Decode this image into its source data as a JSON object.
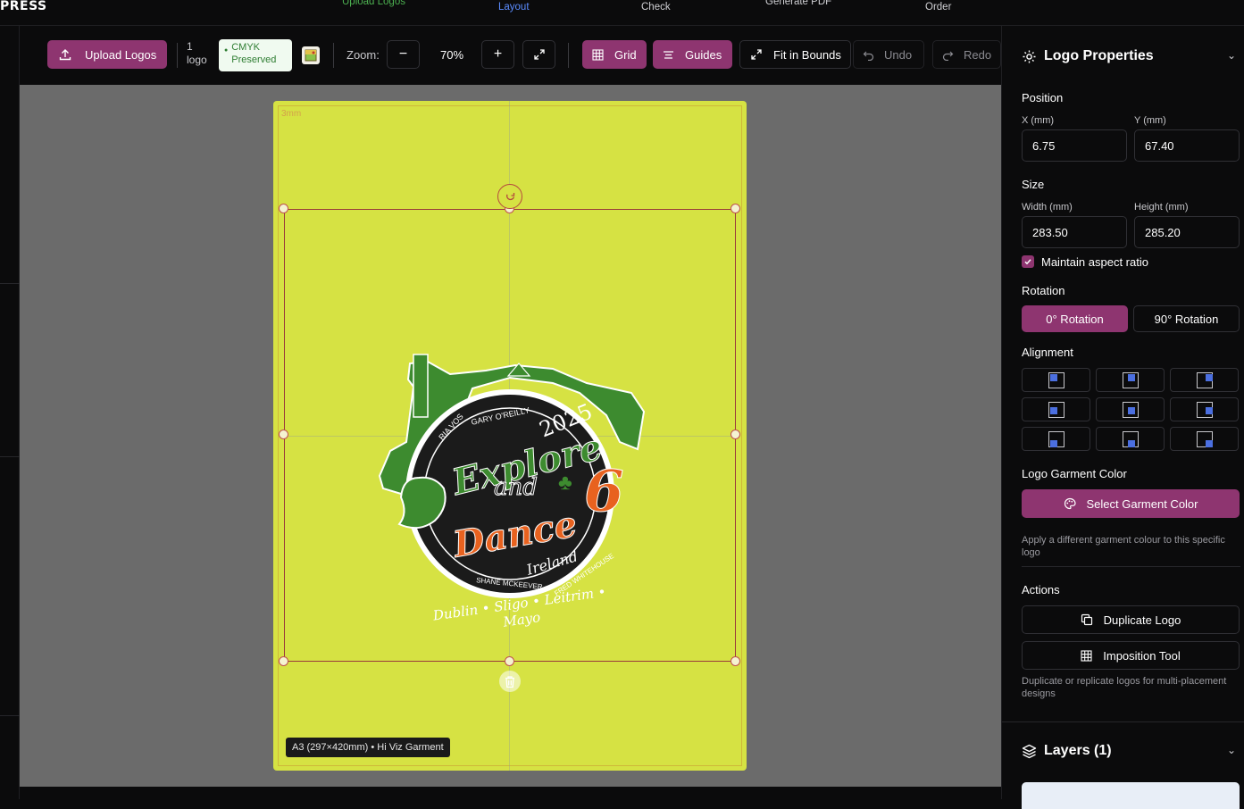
{
  "brand": "PRESS",
  "steps": [
    {
      "label": "Upload Logos",
      "state": "done"
    },
    {
      "label": "Layout",
      "state": "active"
    },
    {
      "label": "Check",
      "state": "todo"
    },
    {
      "label": "Generate PDF",
      "state": "todo"
    },
    {
      "label": "Order",
      "state": "todo"
    }
  ],
  "toolbar": {
    "upload_label": "Upload Logos",
    "logo_count": "1",
    "logo_unit": "logo",
    "cmyk_line1": "CMYK",
    "cmyk_line2": "Preserved",
    "zoom_label": "Zoom:",
    "zoom_value": "70%",
    "grid_label": "Grid",
    "guides_label": "Guides",
    "fit_label": "Fit in Bounds",
    "undo_label": "Undo",
    "redo_label": "Redo"
  },
  "canvas": {
    "bleed_label": "3mm",
    "size_label": "A3 (297×420mm) • Hi Viz Garment",
    "garment_color": "#d6e243"
  },
  "logo": {
    "ring_top_left": "RIA VOS",
    "ring_top": "GARY O'REILLY",
    "year": "2025",
    "word1": "Explore",
    "word2": "and",
    "word3": "Dance",
    "number": "6",
    "script": "Ireland",
    "ring_bottom_left": "SHANE MCKEEVER",
    "ring_bottom_right": "FRED WHITEHOUSE",
    "banner": "Dublin • Sligo • Leitrim • Mayo"
  },
  "sidebar": {
    "title": "Logo Properties",
    "position_label": "Position",
    "x_label": "X (mm)",
    "x_value": "6.75",
    "y_label": "Y (mm)",
    "y_value": "67.40",
    "size_label": "Size",
    "width_label": "Width (mm)",
    "width_value": "283.50",
    "height_label": "Height (mm)",
    "height_value": "285.20",
    "aspect_label": "Maintain aspect ratio",
    "aspect_checked": true,
    "rotation_label": "Rotation",
    "rot0_label": "0° Rotation",
    "rot90_label": "90° Rotation",
    "alignment_label": "Alignment",
    "garment_color_label": "Logo Garment Color",
    "select_color_label": "Select Garment Color",
    "garment_hint": "Apply a different garment colour to this specific logo",
    "actions_label": "Actions",
    "duplicate_label": "Duplicate Logo",
    "imposition_label": "Imposition Tool",
    "actions_hint": "Duplicate or replicate logos for multi-placement designs",
    "layers_label": "Layers (1)"
  },
  "colors": {
    "accent": "#8e3570",
    "active_step": "#5b8cff",
    "done_step": "#4caf50",
    "align_dot": "#4b6fe0"
  }
}
